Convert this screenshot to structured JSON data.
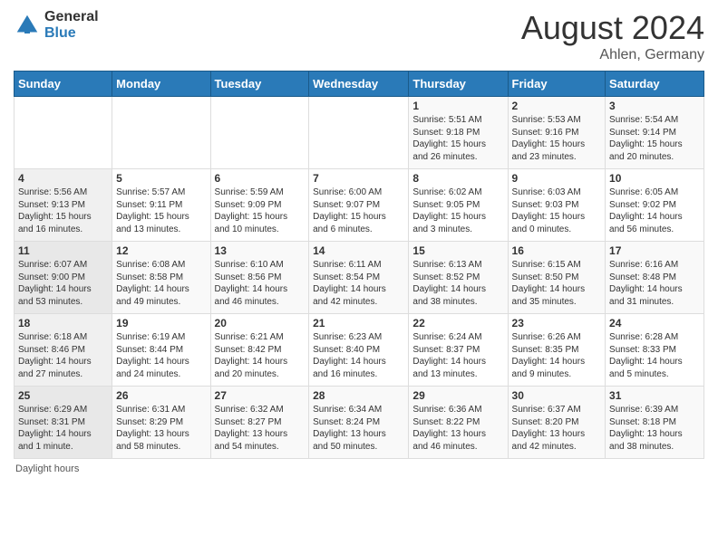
{
  "header": {
    "logo": {
      "general": "General",
      "blue": "Blue"
    },
    "title": "August 2024",
    "location": "Ahlen, Germany"
  },
  "days": [
    "Sunday",
    "Monday",
    "Tuesday",
    "Wednesday",
    "Thursday",
    "Friday",
    "Saturday"
  ],
  "weeks": [
    [
      {
        "day": "",
        "info": ""
      },
      {
        "day": "",
        "info": ""
      },
      {
        "day": "",
        "info": ""
      },
      {
        "day": "",
        "info": ""
      },
      {
        "day": "1",
        "info": "Sunrise: 5:51 AM\nSunset: 9:18 PM\nDaylight: 15 hours\nand 26 minutes."
      },
      {
        "day": "2",
        "info": "Sunrise: 5:53 AM\nSunset: 9:16 PM\nDaylight: 15 hours\nand 23 minutes."
      },
      {
        "day": "3",
        "info": "Sunrise: 5:54 AM\nSunset: 9:14 PM\nDaylight: 15 hours\nand 20 minutes."
      }
    ],
    [
      {
        "day": "4",
        "info": "Sunrise: 5:56 AM\nSunset: 9:13 PM\nDaylight: 15 hours\nand 16 minutes."
      },
      {
        "day": "5",
        "info": "Sunrise: 5:57 AM\nSunset: 9:11 PM\nDaylight: 15 hours\nand 13 minutes."
      },
      {
        "day": "6",
        "info": "Sunrise: 5:59 AM\nSunset: 9:09 PM\nDaylight: 15 hours\nand 10 minutes."
      },
      {
        "day": "7",
        "info": "Sunrise: 6:00 AM\nSunset: 9:07 PM\nDaylight: 15 hours\nand 6 minutes."
      },
      {
        "day": "8",
        "info": "Sunrise: 6:02 AM\nSunset: 9:05 PM\nDaylight: 15 hours\nand 3 minutes."
      },
      {
        "day": "9",
        "info": "Sunrise: 6:03 AM\nSunset: 9:03 PM\nDaylight: 15 hours\nand 0 minutes."
      },
      {
        "day": "10",
        "info": "Sunrise: 6:05 AM\nSunset: 9:02 PM\nDaylight: 14 hours\nand 56 minutes."
      }
    ],
    [
      {
        "day": "11",
        "info": "Sunrise: 6:07 AM\nSunset: 9:00 PM\nDaylight: 14 hours\nand 53 minutes."
      },
      {
        "day": "12",
        "info": "Sunrise: 6:08 AM\nSunset: 8:58 PM\nDaylight: 14 hours\nand 49 minutes."
      },
      {
        "day": "13",
        "info": "Sunrise: 6:10 AM\nSunset: 8:56 PM\nDaylight: 14 hours\nand 46 minutes."
      },
      {
        "day": "14",
        "info": "Sunrise: 6:11 AM\nSunset: 8:54 PM\nDaylight: 14 hours\nand 42 minutes."
      },
      {
        "day": "15",
        "info": "Sunrise: 6:13 AM\nSunset: 8:52 PM\nDaylight: 14 hours\nand 38 minutes."
      },
      {
        "day": "16",
        "info": "Sunrise: 6:15 AM\nSunset: 8:50 PM\nDaylight: 14 hours\nand 35 minutes."
      },
      {
        "day": "17",
        "info": "Sunrise: 6:16 AM\nSunset: 8:48 PM\nDaylight: 14 hours\nand 31 minutes."
      }
    ],
    [
      {
        "day": "18",
        "info": "Sunrise: 6:18 AM\nSunset: 8:46 PM\nDaylight: 14 hours\nand 27 minutes."
      },
      {
        "day": "19",
        "info": "Sunrise: 6:19 AM\nSunset: 8:44 PM\nDaylight: 14 hours\nand 24 minutes."
      },
      {
        "day": "20",
        "info": "Sunrise: 6:21 AM\nSunset: 8:42 PM\nDaylight: 14 hours\nand 20 minutes."
      },
      {
        "day": "21",
        "info": "Sunrise: 6:23 AM\nSunset: 8:40 PM\nDaylight: 14 hours\nand 16 minutes."
      },
      {
        "day": "22",
        "info": "Sunrise: 6:24 AM\nSunset: 8:37 PM\nDaylight: 14 hours\nand 13 minutes."
      },
      {
        "day": "23",
        "info": "Sunrise: 6:26 AM\nSunset: 8:35 PM\nDaylight: 14 hours\nand 9 minutes."
      },
      {
        "day": "24",
        "info": "Sunrise: 6:28 AM\nSunset: 8:33 PM\nDaylight: 14 hours\nand 5 minutes."
      }
    ],
    [
      {
        "day": "25",
        "info": "Sunrise: 6:29 AM\nSunset: 8:31 PM\nDaylight: 14 hours\nand 1 minute."
      },
      {
        "day": "26",
        "info": "Sunrise: 6:31 AM\nSunset: 8:29 PM\nDaylight: 13 hours\nand 58 minutes."
      },
      {
        "day": "27",
        "info": "Sunrise: 6:32 AM\nSunset: 8:27 PM\nDaylight: 13 hours\nand 54 minutes."
      },
      {
        "day": "28",
        "info": "Sunrise: 6:34 AM\nSunset: 8:24 PM\nDaylight: 13 hours\nand 50 minutes."
      },
      {
        "day": "29",
        "info": "Sunrise: 6:36 AM\nSunset: 8:22 PM\nDaylight: 13 hours\nand 46 minutes."
      },
      {
        "day": "30",
        "info": "Sunrise: 6:37 AM\nSunset: 8:20 PM\nDaylight: 13 hours\nand 42 minutes."
      },
      {
        "day": "31",
        "info": "Sunrise: 6:39 AM\nSunset: 8:18 PM\nDaylight: 13 hours\nand 38 minutes."
      }
    ]
  ],
  "footer": "Daylight hours"
}
